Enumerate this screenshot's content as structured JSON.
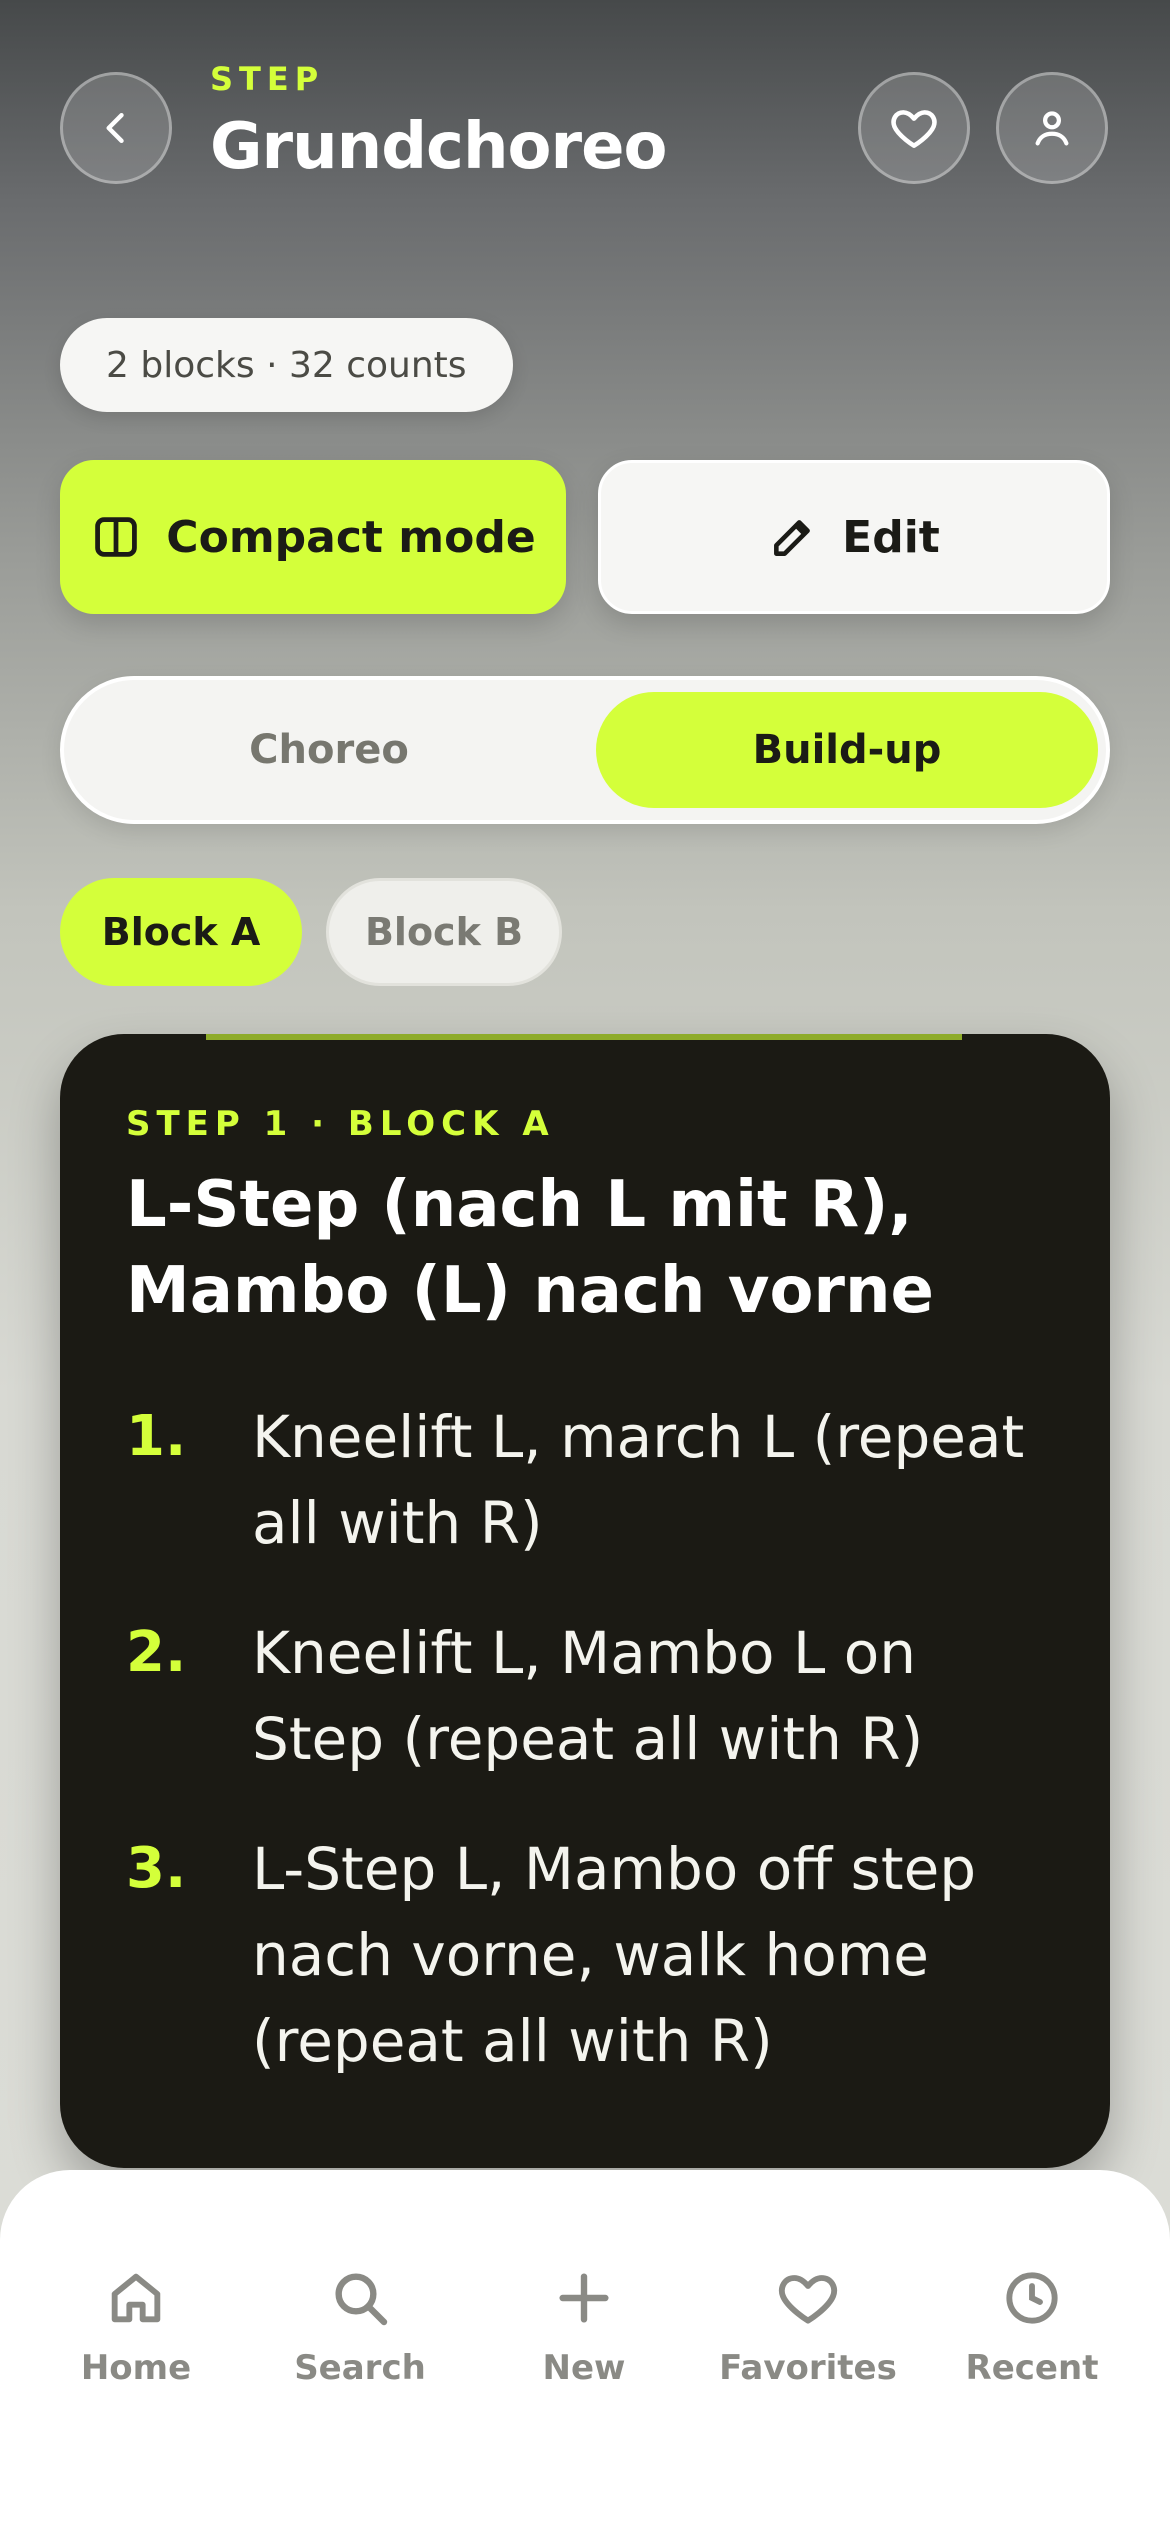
{
  "header": {
    "eyebrow": "STEP",
    "title": "Grundchoreo",
    "back_icon": "chevron-left-icon",
    "favorite_icon": "heart-icon",
    "profile_icon": "user-icon"
  },
  "meta": {
    "summary": "2 blocks · 32 counts"
  },
  "actions": {
    "compact_label": "Compact mode",
    "compact_icon": "columns-icon",
    "edit_label": "Edit",
    "edit_icon": "pencil-icon"
  },
  "segment": {
    "options": [
      "Choreo",
      "Build-up"
    ],
    "selected": "Build-up"
  },
  "blocks": {
    "chips": [
      "Block A",
      "Block B"
    ],
    "selected": "Block A"
  },
  "card": {
    "eyebrow": "STEP 1 · BLOCK A",
    "title_line1": "L-Step (nach L mit R),",
    "title_line2": "Mambo (L) nach vorne",
    "steps": [
      {
        "num": "1.",
        "line1": "Kneelift L, march L (repeat",
        "line2": "all with R)",
        "line3": ""
      },
      {
        "num": "2.",
        "line1": "Kneelift L, Mambo L on",
        "line2": "Step (repeat all with R)",
        "line3": ""
      },
      {
        "num": "3.",
        "line1": "L-Step L, Mambo off step",
        "line2": "nach vorne, walk home",
        "line3": "(repeat all with R)"
      }
    ]
  },
  "nav": {
    "items": [
      {
        "label": "Home",
        "icon": "home-icon"
      },
      {
        "label": "Search",
        "icon": "search-icon"
      },
      {
        "label": "New",
        "icon": "plus-icon"
      },
      {
        "label": "Favorites",
        "icon": "heart-icon"
      },
      {
        "label": "Recent",
        "icon": "clock-icon"
      }
    ]
  },
  "colors": {
    "accent": "#d4ff3a",
    "card_bg": "#1b1a14",
    "nav_label": "#8a8a85"
  }
}
